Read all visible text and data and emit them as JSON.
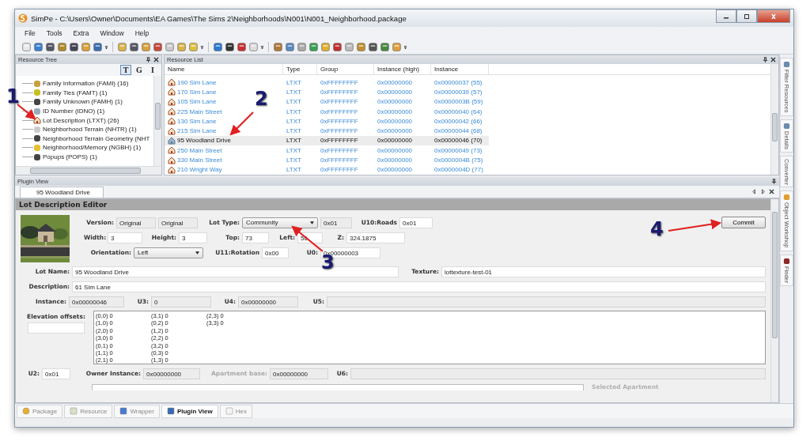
{
  "window": {
    "title": "SimPe - C:\\Users\\Owner\\Documents\\EA Games\\The Sims 2\\Neighborhoods\\N001\\N001_Neighborhood.package"
  },
  "menu": [
    "File",
    "Tools",
    "Extra",
    "Window",
    "Help"
  ],
  "resource_tree": {
    "title": "Resource Tree",
    "view_buttons": [
      {
        "label": "T",
        "selected": true
      },
      {
        "label": "G",
        "selected": false
      },
      {
        "label": "I",
        "selected": false
      }
    ],
    "items": [
      "Family Information (FAMI) (16)",
      "Family Ties (FAMT) (1)",
      "Family Unknown (FAMH) (1)",
      "ID Number (IDNO) (1)",
      "Lot Description (LTXT) (26)",
      "Neighborhood Terrain (NHTR) (1)",
      "Neighborhood Terrain Geometry (NHT",
      "Neighborhood/Memory (NGBH) (1)",
      "Popups (POPS) (1)"
    ]
  },
  "resource_list": {
    "title": "Resource List",
    "columns": [
      "Name",
      "Type",
      "Group",
      "Instance (high)",
      "Instance"
    ],
    "rows": [
      {
        "cells": [
          "190 Sim Lane",
          "LTXT",
          "0xFFFFFFFF",
          "0x00000000",
          "0x00000037 (55)"
        ],
        "selected": false
      },
      {
        "cells": [
          "170 Sim Lane",
          "LTXT",
          "0xFFFFFFFF",
          "0x00000000",
          "0x00000039 (57)"
        ],
        "selected": false
      },
      {
        "cells": [
          "105 Sim Lane",
          "LTXT",
          "0xFFFFFFFF",
          "0x00000000",
          "0x0000003B (59)"
        ],
        "selected": false
      },
      {
        "cells": [
          "225 Main Street",
          "LTXT",
          "0xFFFFFFFF",
          "0x00000000",
          "0x00000040 (64)"
        ],
        "selected": false
      },
      {
        "cells": [
          "130 Sim Lane",
          "LTXT",
          "0xFFFFFFFF",
          "0x00000000",
          "0x00000042 (66)"
        ],
        "selected": false
      },
      {
        "cells": [
          "215 Sim Lane",
          "LTXT",
          "0xFFFFFFFF",
          "0x00000000",
          "0x00000044 (68)"
        ],
        "selected": false
      },
      {
        "cells": [
          "95 Woodland Drive",
          "LTXT",
          "0xFFFFFFFF",
          "0x00000000",
          "0x00000046 (70)"
        ],
        "selected": true
      },
      {
        "cells": [
          "250 Main Street",
          "LTXT",
          "0xFFFFFFFF",
          "0x00000000",
          "0x00000049 (73)"
        ],
        "selected": false
      },
      {
        "cells": [
          "330 Main Street",
          "LTXT",
          "0xFFFFFFFF",
          "0x00000000",
          "0x0000004B (75)"
        ],
        "selected": false
      },
      {
        "cells": [
          "210 Wright Way",
          "LTXT",
          "0xFFFFFFFF",
          "0x00000000",
          "0x0000004D (77)"
        ],
        "selected": false
      }
    ]
  },
  "plugin_view": {
    "title": "Plugin View",
    "tab": "95 Woodland Drive",
    "editor": {
      "title": "Lot Description Editor",
      "commit": "Commit",
      "top_rows": [
        [
          {
            "kind": "label",
            "text": "Version:"
          },
          {
            "kind": "field",
            "text": "Original",
            "readonly": true
          },
          {
            "kind": "field",
            "text": "Original",
            "readonly": true
          },
          {
            "kind": "label",
            "text": "Lot Type:"
          },
          {
            "kind": "dropdown",
            "text": "Community"
          },
          {
            "kind": "field",
            "text": "0x01",
            "readonly": true
          },
          {
            "kind": "label",
            "text": "U10:Roads"
          },
          {
            "kind": "field",
            "text": "0x01",
            "readonly": false
          }
        ],
        [
          {
            "kind": "label",
            "text": "Width:"
          },
          {
            "kind": "field",
            "text": "3",
            "readonly": false
          },
          {
            "kind": "label",
            "text": "Height:"
          },
          {
            "kind": "field",
            "text": "3",
            "readonly": false
          },
          {
            "kind": "label",
            "text": "Top:"
          },
          {
            "kind": "field",
            "text": "73",
            "readonly": false
          },
          {
            "kind": "label",
            "text": "Left:"
          },
          {
            "kind": "field",
            "text": "56",
            "readonly": false
          },
          {
            "kind": "label",
            "text": "Z:"
          },
          {
            "kind": "field",
            "text": "324.1875",
            "readonly": false
          }
        ],
        [
          {
            "kind": "label",
            "text": "Orientation:"
          },
          {
            "kind": "dropdown",
            "text": "Left"
          },
          {
            "kind": "label",
            "text": "U11:Rotation"
          },
          {
            "kind": "field",
            "text": "0x00",
            "readonly": false
          },
          {
            "kind": "label",
            "text": "U0:"
          },
          {
            "kind": "field",
            "text": "0x00000003",
            "readonly": false
          }
        ]
      ],
      "lot_name": {
        "label": "Lot Name:",
        "value": "95 Woodland Drive"
      },
      "texture": {
        "label": "Texture:",
        "value": "lottexture-test-01"
      },
      "description": {
        "label": "Description:",
        "value": "61 Sim Lane"
      },
      "id_row": [
        {
          "kind": "label",
          "text": "Instance:"
        },
        {
          "kind": "field",
          "text": "0x00000046",
          "readonly": true
        },
        {
          "kind": "label",
          "text": "U3:"
        },
        {
          "kind": "field",
          "text": "0",
          "readonly": true
        },
        {
          "kind": "label",
          "text": "U4:"
        },
        {
          "kind": "field",
          "text": "0x00000000",
          "readonly": true
        },
        {
          "kind": "label",
          "text": "U5:"
        },
        {
          "kind": "field",
          "readonly": true
        }
      ],
      "elevation": {
        "label": "Elevation offsets:",
        "offsets": [
          "(0,0) 0",
          "(1,0) 0",
          "(2,0) 0",
          "(3,0) 0",
          "(0,1) 0",
          "(1,1) 0",
          "(2,1) 0",
          "(3,1) 0",
          "(0,2) 0",
          "(1,2) 0",
          "(2,2) 0",
          "(3,2) 0",
          "(0,3) 0",
          "(1,3) 0",
          "(2,3) 0",
          "(3,3) 0"
        ]
      },
      "owner_row": [
        {
          "kind": "label",
          "text": "U2:",
          "disabled": false
        },
        {
          "kind": "field",
          "text": "0x01",
          "readonly": false
        },
        {
          "kind": "label",
          "text": "Owner Instance:",
          "disabled": false
        },
        {
          "kind": "field",
          "text": "0x00000000",
          "readonly": true
        },
        {
          "kind": "label",
          "text": "Apartment base:",
          "disabled": true
        },
        {
          "kind": "field",
          "text": "0x00000000",
          "readonly": true
        },
        {
          "kind": "label",
          "text": "U6:",
          "disabled": false
        },
        {
          "kind": "field",
          "readonly": true
        }
      ],
      "selected_apartment": "Selected Apartment"
    }
  },
  "side_tabs": [
    "Filter Resources",
    "Details",
    "Converter",
    "Object Workshop",
    "Finder"
  ],
  "bottom_tabs": [
    {
      "label": "Package",
      "selected": false
    },
    {
      "label": "Resource",
      "selected": false
    },
    {
      "label": "Wrapper",
      "selected": false
    },
    {
      "label": "Plugin View",
      "selected": true
    },
    {
      "label": "Hex",
      "selected": false
    }
  ],
  "annotations": [
    {
      "label": "1"
    },
    {
      "label": "2"
    },
    {
      "label": "3"
    },
    {
      "label": "4"
    }
  ]
}
